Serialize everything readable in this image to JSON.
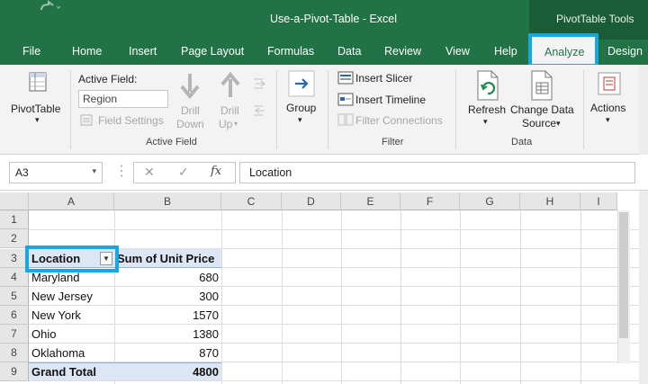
{
  "titlebar": {
    "doc_title": "Use-a-Pivot-Table  -  Excel",
    "tools_label": "PivotTable Tools"
  },
  "tabs": [
    "File",
    "Home",
    "Insert",
    "Page Layout",
    "Formulas",
    "Data",
    "Review",
    "View",
    "Help",
    "Analyze",
    "Design"
  ],
  "ribbon": {
    "pivottable_label": "PivotTable",
    "active_field_label": "Active Field:",
    "active_field_value": "Region",
    "field_settings_label": "Field Settings",
    "drill_down_label_1": "Drill",
    "drill_down_label_2": "Down",
    "drill_up_label_1": "Drill",
    "drill_up_label_2": "Up",
    "active_field_group": "Active Field",
    "group_label": "Group",
    "insert_slicer": "Insert Slicer",
    "insert_timeline": "Insert Timeline",
    "filter_connections": "Filter Connections",
    "filter_group": "Filter",
    "refresh_label": "Refresh",
    "change_source_label_1": "Change Data",
    "change_source_label_2": "Source",
    "data_group": "Data",
    "actions_label": "Actions"
  },
  "formula_bar": {
    "name_box": "A3",
    "cancel_symbol": "✕",
    "enter_symbol": "✓",
    "fx_symbol": "fx",
    "formula": "Location"
  },
  "columns": [
    "A",
    "B",
    "C",
    "D",
    "E",
    "F",
    "G",
    "H",
    "I"
  ],
  "rows": [
    "1",
    "2",
    "3",
    "4",
    "5",
    "6",
    "7",
    "8",
    "9"
  ],
  "pivot": {
    "header_location": "Location",
    "header_sum": "Sum of Unit Price",
    "data": [
      {
        "location": "Maryland",
        "value": "680"
      },
      {
        "location": "New Jersey",
        "value": "300"
      },
      {
        "location": "New York",
        "value": "1570"
      },
      {
        "location": "Ohio",
        "value": "1380"
      },
      {
        "location": "Oklahoma",
        "value": "870"
      }
    ],
    "total_label": "Grand Total",
    "total_value": "4800"
  },
  "colors": {
    "excel_green": "#217346",
    "highlight_blue": "#17a8e3",
    "pivot_header": "#dde6f4"
  }
}
